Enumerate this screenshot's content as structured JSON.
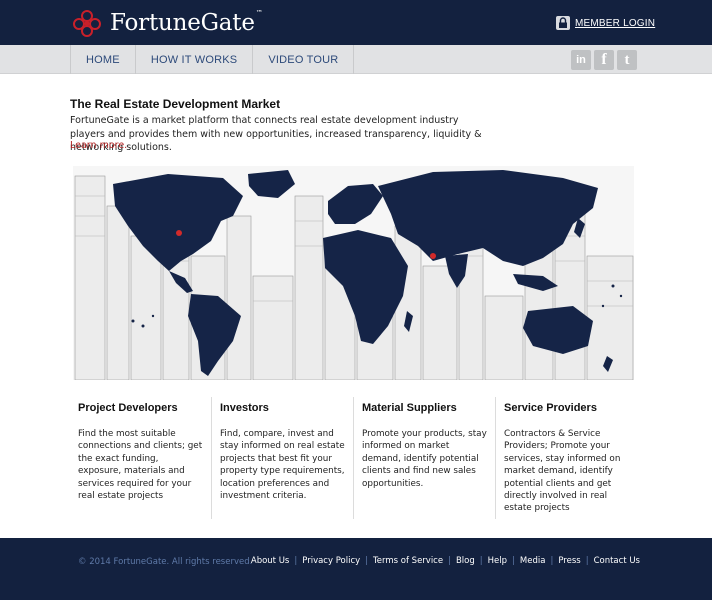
{
  "header": {
    "logo_text": "FortuneGate",
    "logo_tm": "™",
    "member_login": "MEMBER LOGIN"
  },
  "nav": {
    "items": [
      {
        "label": "HOME"
      },
      {
        "label": "HOW IT WORKS"
      },
      {
        "label": "VIDEO TOUR"
      }
    ],
    "social": [
      {
        "icon": "linkedin-icon",
        "glyph": "in"
      },
      {
        "icon": "facebook-icon",
        "glyph": "f"
      },
      {
        "icon": "twitter-icon",
        "glyph": "t"
      }
    ]
  },
  "intro": {
    "headline": "The Real Estate Development Market",
    "description": "FortuneGate is a market platform that connects real estate development industry players and provides them with new opportunities, increased transparency, liquidity & networking solutions.",
    "learn_more": "Learn more."
  },
  "columns": [
    {
      "title": "Project Developers",
      "text": "Find the most suitable connections and clients; get the exact funding, exposure, materials and services required for your real estate projects"
    },
    {
      "title": "Investors",
      "text": "Find, compare, invest and stay informed on real estate projects that best fit your property type requirements, location preferences and investment criteria."
    },
    {
      "title": "Material Suppliers",
      "text": "Promote your products, stay informed on market demand, identify potential clients and find new sales opportunities."
    },
    {
      "title": "Service Providers",
      "text": "Contractors & Service Providers; Promote your services, stay informed on market demand, identify potential clients and get directly involved in real estate projects"
    }
  ],
  "footer": {
    "copyright": "© 2014 FortuneGate. All rights reserved.",
    "links": [
      "About Us",
      "Privacy Policy",
      "Terms of Service",
      "Blog",
      "Help",
      "Media",
      "Press",
      "Contact Us"
    ]
  },
  "colors": {
    "navy": "#13213f",
    "nav_bg": "#e1e2e4",
    "nav_text": "#2d4a7a",
    "accent_red": "#b02020",
    "map_land": "#152447"
  }
}
